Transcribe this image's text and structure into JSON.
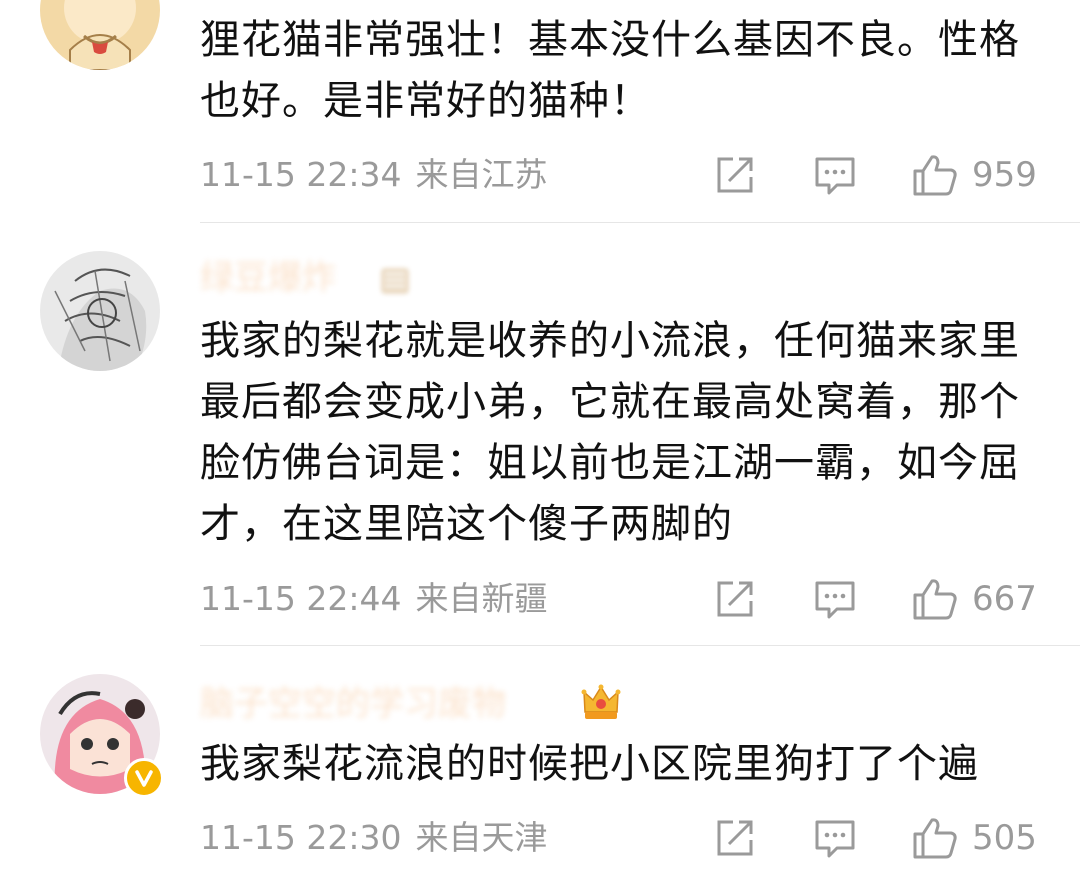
{
  "comments": [
    {
      "text": "狸花猫非常强壮！基本没什么基因不良。性格也好。是非常好的猫种！",
      "time": "11-15 22:34",
      "location": "来自江苏",
      "likes": "959"
    },
    {
      "username": "绿豆爆炸",
      "text": "我家的梨花就是收养的小流浪，任何猫来家里最后都会变成小弟，它就在最高处窝着，那个脸仿佛台词是：姐以前也是江湖一霸，如今屈才，在这里陪这个傻子两脚的",
      "time": "11-15 22:44",
      "location": "来自新疆",
      "likes": "667"
    },
    {
      "username": "脑子空空的学习废物",
      "text": "我家梨花流浪的时候把小区院里狗打了个遍",
      "time": "11-15 22:30",
      "location": "来自天津",
      "likes": "505"
    }
  ],
  "icons": {
    "share": "share-icon",
    "comment": "comment-icon",
    "like": "thumbs-up-icon",
    "medal": "crown-medal-icon",
    "verified": "verified-v-icon"
  },
  "colors": {
    "meta_gray": "#9a9a9a",
    "username_orange": "#f29a4a",
    "verified_yellow": "#f7b500",
    "divider": "#e6e6e6"
  }
}
